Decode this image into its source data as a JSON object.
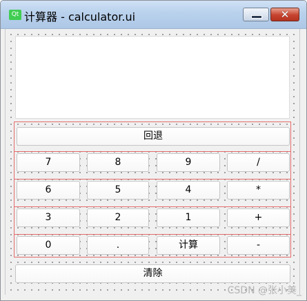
{
  "window": {
    "title": "计算器 - calculator.ui",
    "app_icon_text": "Qt",
    "minimize_icon": "minimize-icon",
    "close_label": "✕"
  },
  "display": {
    "value": ""
  },
  "buttons": {
    "back": "回退",
    "rows": [
      [
        "7",
        "8",
        "9",
        "/"
      ],
      [
        "6",
        "5",
        "4",
        "*"
      ],
      [
        "3",
        "2",
        "1",
        "+"
      ],
      [
        "0",
        ".",
        "计算",
        "-"
      ]
    ],
    "clear": "清除"
  },
  "watermark": "CSDN @张小美_"
}
